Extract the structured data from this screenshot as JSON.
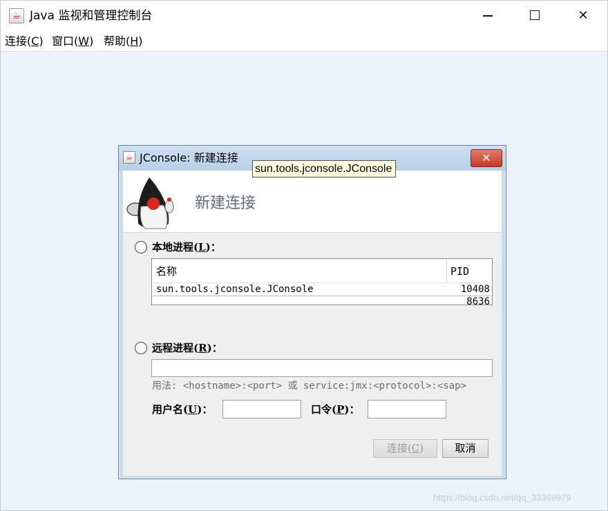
{
  "window": {
    "title": "Java 监视和管理控制台",
    "icon": "java-coffee-icon",
    "controls": {
      "minimize": "minimize-icon",
      "maximize": "maximize-icon",
      "close": "✕"
    }
  },
  "menubar": {
    "connect_label": "连接(",
    "connect_key": "C",
    "window_label": "窗口(",
    "window_key": "W",
    "help_label": "帮助(",
    "help_key": "H",
    "close_paren": ")"
  },
  "dialog": {
    "title": "JConsole: 新建连接",
    "close": "✕",
    "banner_title": "新建连接",
    "local": {
      "label": "本地进程",
      "mnemonic": "L",
      "columns": {
        "name": "名称",
        "pid": "PID"
      },
      "rows": [
        {
          "name": "sun.tools.jconsole.JConsole",
          "pid": "10408"
        },
        {
          "name": "",
          "pid": "8636"
        }
      ]
    },
    "tooltip": "sun.tools.jconsole.JConsole",
    "remote": {
      "label": "远程进程",
      "mnemonic": "R",
      "value": "",
      "usage_lead": "用法",
      "usage_text": ": <hostname>:<port> 或 service:jmx:<protocol>:<sap>"
    },
    "username": {
      "label": "用户名",
      "mnemonic": "U",
      "value": ""
    },
    "password": {
      "label": "口令",
      "mnemonic": "P",
      "value": ""
    },
    "buttons": {
      "connect": "连接",
      "connect_mnemonic": "C",
      "cancel": "取消"
    }
  },
  "watermark": "https://blog.csdn.net/qq_33369979",
  "colors": {
    "desktop": "#eaf2fb",
    "dialog_frame": "#c9ddef",
    "banner_title": "#596e80",
    "close_button": "#c23a28",
    "tooltip_bg": "#fdfde2"
  }
}
